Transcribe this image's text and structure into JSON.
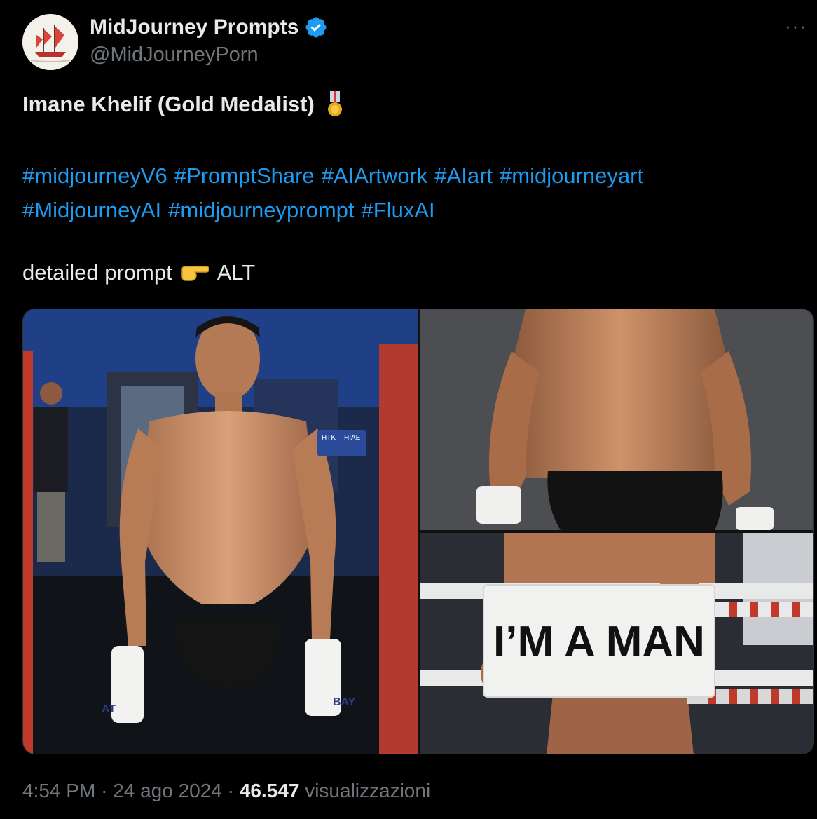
{
  "author": {
    "name": "MidJourney Prompts",
    "handle": "@MidJourneyPorn",
    "avatar_icon": "sailing-ship-icon",
    "verified_icon": "verified-badge-icon",
    "verified_color": "#1d9bf0"
  },
  "more_label": "···",
  "tweet": {
    "title": "Imane Khelif (Gold Medalist)",
    "title_icon": "military-medal-emoji",
    "hashtags": [
      "#midjourneyV6",
      "#PromptShare",
      "#AIArtwork",
      "#AIart",
      "#midjourneyart",
      "#MidjourneyAI",
      "#midjourneyprompt",
      "#FluxAI"
    ],
    "detail_prefix": "detailed prompt",
    "detail_icon": "pointing-right-emoji",
    "detail_suffix": "ALT"
  },
  "media": {
    "sign_text": "I’M A MAN",
    "card_left": "HTK",
    "card_right": "HIAE",
    "wrap_text_left": "AT",
    "wrap_text_right": "BAY"
  },
  "footer": {
    "time": "4:54 PM",
    "sep": "·",
    "date": "24 ago 2024",
    "views": "46.547",
    "views_label": "visualizzazioni"
  },
  "colors": {
    "link": "#1d9bf0",
    "muted": "#71767b",
    "text": "#e7e9ea",
    "bg": "#000000"
  }
}
